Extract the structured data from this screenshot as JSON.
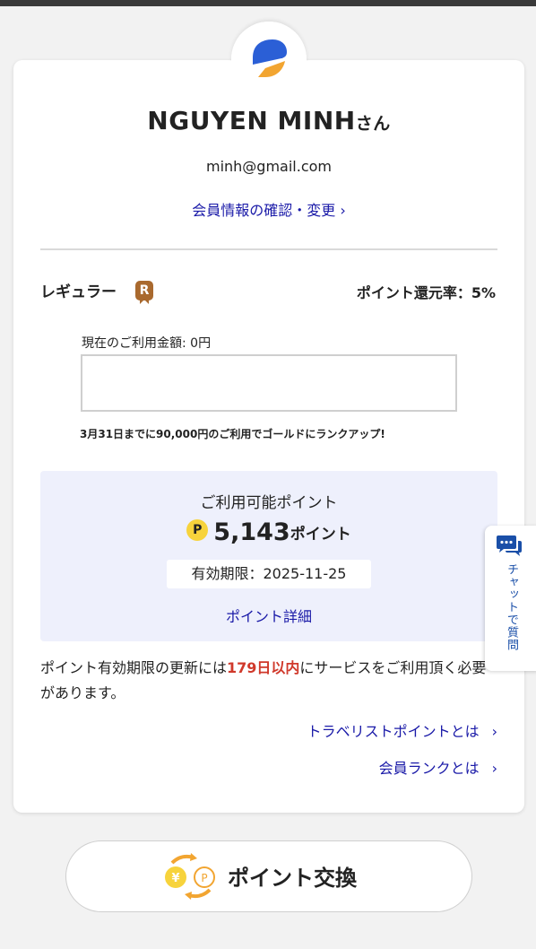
{
  "header": {
    "user_name": "NGUYEN MINH",
    "honorific": "さん",
    "email": "minh@gmail.com",
    "member_info_link": "会員情報の確認・変更 ›"
  },
  "rank": {
    "name": "レギュラー",
    "badge_letter": "R",
    "badge_color": "#a9692e",
    "return_rate": "ポイント還元率：5%"
  },
  "usage": {
    "label": "現在のご利用金額: 0円",
    "progress_fraction": 0.0,
    "rankup_note": "3月31日までに90,000円のご利用でゴールドにランクアップ!"
  },
  "points": {
    "available_label": "ご利用可能ポイント",
    "icon_letter": "P",
    "value": "5,143",
    "unit": "ポイント",
    "expiry": "有効期限：2025-11-25",
    "detail_link": "ポイント詳細"
  },
  "notice": {
    "before": "ポイント有効期限の更新には",
    "highlight": "179日以内",
    "after": "にサービスをご利用頂く必要があります。"
  },
  "links": [
    {
      "label": "トラベリストポイントとは",
      "chevron": "›"
    },
    {
      "label": "会員ランクとは",
      "chevron": "›"
    }
  ],
  "chat": {
    "label": "チャットで質問",
    "icon": "chat-bubble-icon"
  },
  "exchange_button": {
    "label": "ポイント交換",
    "icon": "yen-point-exchange-icon"
  },
  "colors": {
    "link": "#1a1aa8",
    "highlight": "#d0392b",
    "panel": "#eef0fc",
    "point_coin": "#f7d33c",
    "logo_blue": "#2b5fd6",
    "logo_yellow": "#f2a531"
  }
}
